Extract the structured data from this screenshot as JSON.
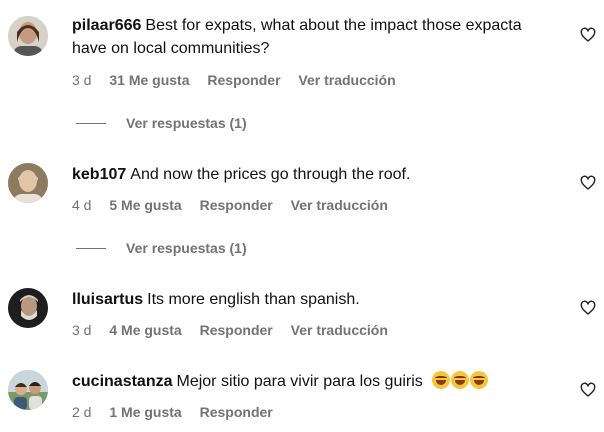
{
  "comments": [
    {
      "username": "pilaar666",
      "text": "Best for expats, what about the impact those expacta have on local communities?",
      "time": "3 d",
      "likes": "31 Me gusta",
      "reply": "Responder",
      "translate": "Ver traducción",
      "replies_label": "Ver respuestas (1)",
      "avatar_color": "#6b4a3a"
    },
    {
      "username": "keb107",
      "text": "And now the prices go through the roof.",
      "time": "4 d",
      "likes": "5 Me gusta",
      "reply": "Responder",
      "translate": "Ver traducción",
      "replies_label": "Ver respuestas (1)",
      "avatar_color": "#a98c6a"
    },
    {
      "username": "lluisartus",
      "text": "Its more english than spanish.",
      "time": "3 d",
      "likes": "4 Me gusta",
      "reply": "Responder",
      "translate": "Ver traducción",
      "avatar_color": "#2b2b2b"
    },
    {
      "username": "cucinastanza",
      "text": "Mejor sitio para vivir para los guiris",
      "emoji": "😂😂😂",
      "time": "2 d",
      "likes": "1 Me gusta",
      "reply": "Responder",
      "avatar_color": "#7b9a6a"
    }
  ],
  "colors": {
    "text": "#111111",
    "meta": "#737373",
    "emoji": "#f7c53b"
  },
  "icons": {
    "like": "heart-outline-icon"
  }
}
